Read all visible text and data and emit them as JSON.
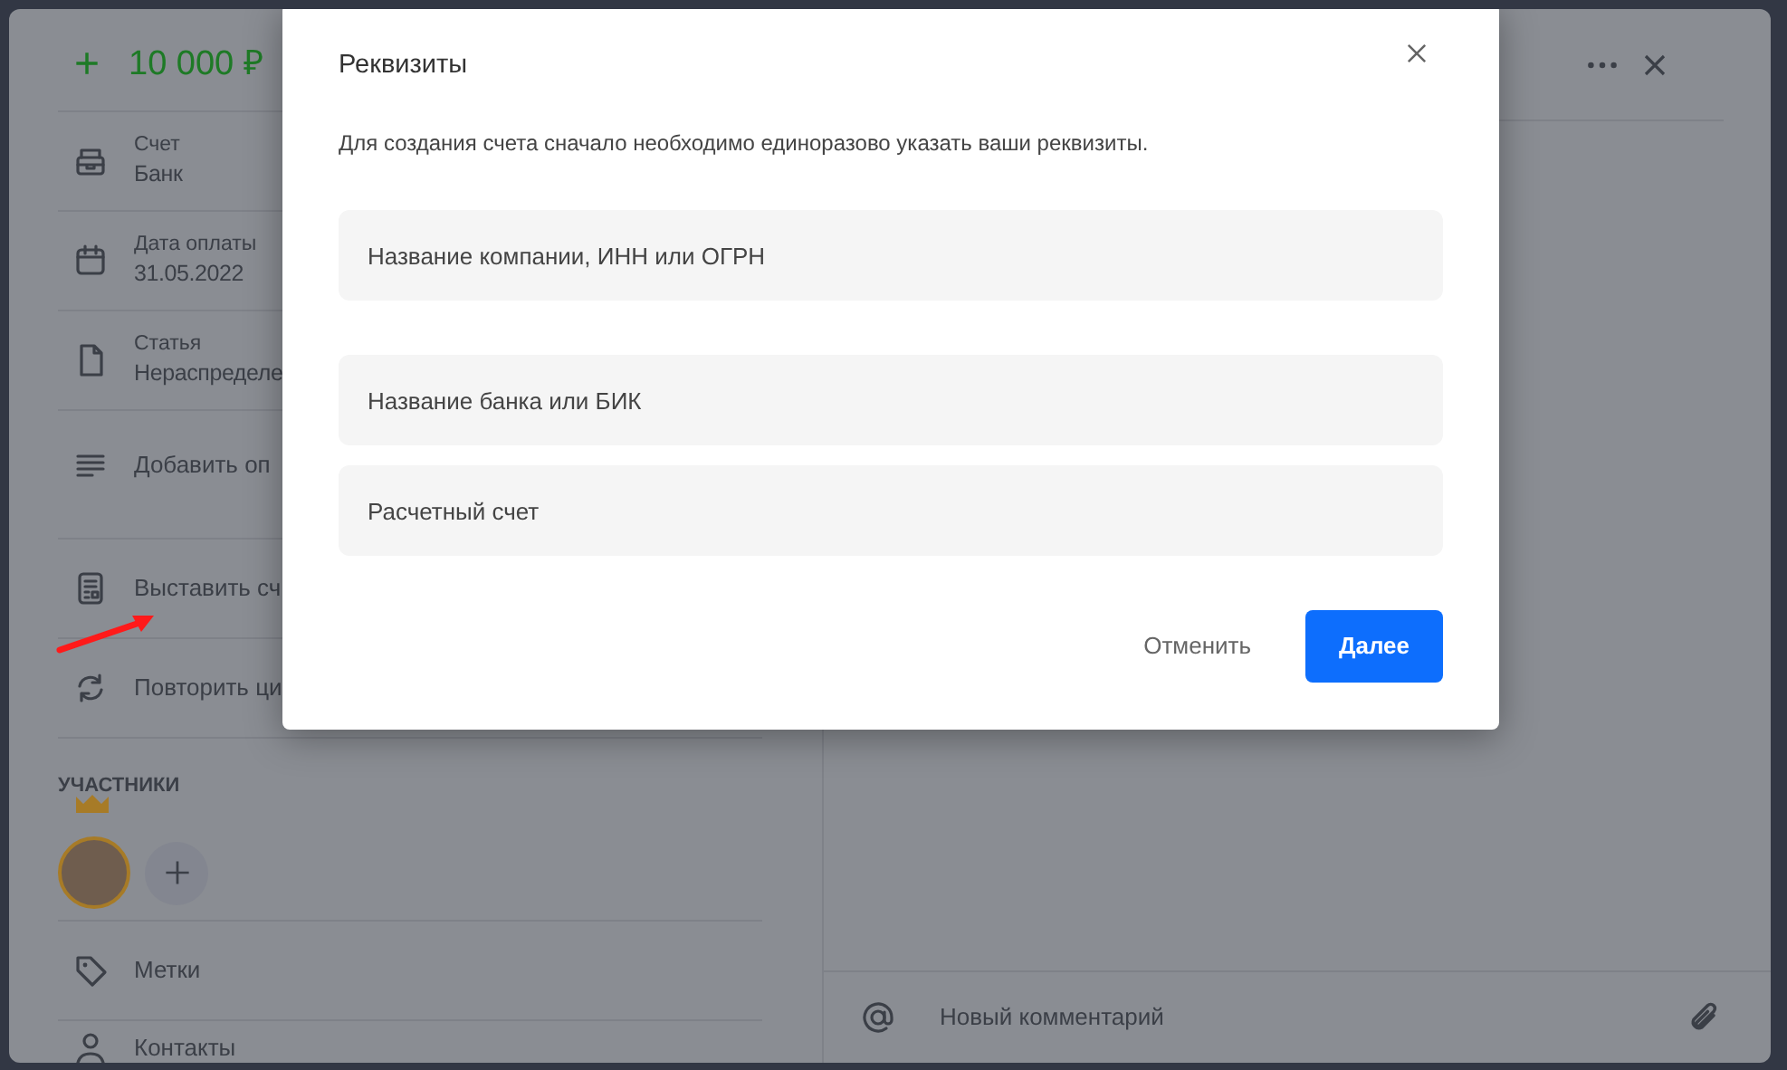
{
  "operation": {
    "sign": "+",
    "amount": "10 000 ₽"
  },
  "details": [
    {
      "kind": "field",
      "label": "Счет",
      "value": "Банк"
    },
    {
      "kind": "field",
      "label": "Дата оплаты",
      "value": "31.05.2022"
    },
    {
      "kind": "field",
      "label": "Статья",
      "value": "Нераспределе"
    },
    {
      "kind": "action",
      "text": "Добавить оп"
    }
  ],
  "actions": [
    {
      "text": "Выставить сч"
    },
    {
      "text": "Повторить ци"
    }
  ],
  "participants": {
    "title": "УЧАСТНИКИ"
  },
  "links": [
    {
      "text": "Метки"
    },
    {
      "text": "Контакты"
    }
  ],
  "comment": {
    "placeholder": "Новый комментарий"
  },
  "modal": {
    "title": "Реквизиты",
    "description": "Для создания счета сначало необходимо единоразово указать ваши реквизиты.",
    "fields": [
      {
        "placeholder": "Название компании, ИНН или ОГРН"
      },
      {
        "placeholder": "Название банка или БИК"
      },
      {
        "placeholder": "Расчетный счет"
      }
    ],
    "buttons": [
      {
        "kind": "secondary",
        "text": "Отменить"
      },
      {
        "kind": "primary",
        "text": "Далее"
      }
    ]
  }
}
